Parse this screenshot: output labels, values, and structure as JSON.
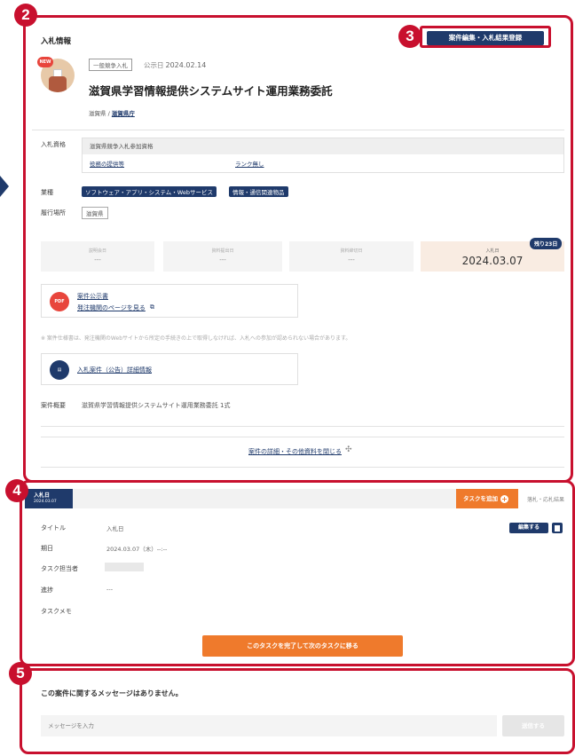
{
  "markers": {
    "n2": "2",
    "n3": "3",
    "n4": "4",
    "n5": "5"
  },
  "section": {
    "title": "入札情報",
    "edit_button": "案件編集・入札結果登録"
  },
  "bid": {
    "new_label": "NEW",
    "type": "一般競争入札",
    "publish_label": "公示日",
    "publish_date": "2024.02.14",
    "title": "滋賀県学習情報提供システムサイト運用業務委託",
    "pref": "滋賀県",
    "sep": " / ",
    "agency": "滋賀県庁"
  },
  "qualification": {
    "label": "入札資格",
    "head": "滋賀県競争入札参加資格",
    "link1": "役務の提供等",
    "link2": "ランク無し"
  },
  "industry": {
    "label": "業種",
    "tags": [
      "ソフトウェア・アプリ・システム・Webサービス",
      "情報・通信関連物品"
    ]
  },
  "location": {
    "label": "履行場所",
    "value": "滋賀県"
  },
  "dates": [
    {
      "label": "説明会日",
      "value": "---"
    },
    {
      "label": "資料提出日",
      "value": "---"
    },
    {
      "label": "資料締切日",
      "value": "---"
    },
    {
      "label": "入札日",
      "value": "2024.03.07"
    }
  ],
  "remaining": "残り23日",
  "docs": {
    "notice_title": "案件公示書",
    "notice_link": "発注機関のページを見る",
    "note": "※ 案件仕様書は、発注機関のWebサイトから所定の手続きの上で取得しなければ、入札への参加が認められない場合があります。",
    "detail_title": "入札案件（公告）詳細情報"
  },
  "summary": {
    "label": "案件概要",
    "value": "滋賀県学習情報提供システムサイト運用業務委託 1式"
  },
  "close_link": "案件の詳細・その他資料を閉じる",
  "task": {
    "tab_title": "入札日",
    "tab_date": "2024.03.07",
    "add_button": "タスクを追加",
    "other_tab": "落札・応札結果",
    "fields": [
      {
        "label": "タイトル",
        "value": "入札日"
      },
      {
        "label": "期日",
        "value": "2024.03.07（木）--:--"
      },
      {
        "label": "タスク担当者",
        "value": ""
      },
      {
        "label": "進捗",
        "value": "---"
      },
      {
        "label": "タスクメモ",
        "value": ""
      }
    ],
    "edit_button": "編集する",
    "complete_button": "このタスクを完了して次のタスクに移る"
  },
  "messages": {
    "empty": "この案件に関するメッセージはありません。",
    "placeholder": "メッセージを入力",
    "send_button": "送信する"
  },
  "colors": {
    "navy": "#1f3a6b",
    "orange": "#ef7a2c",
    "marker_red": "#c8102e"
  }
}
